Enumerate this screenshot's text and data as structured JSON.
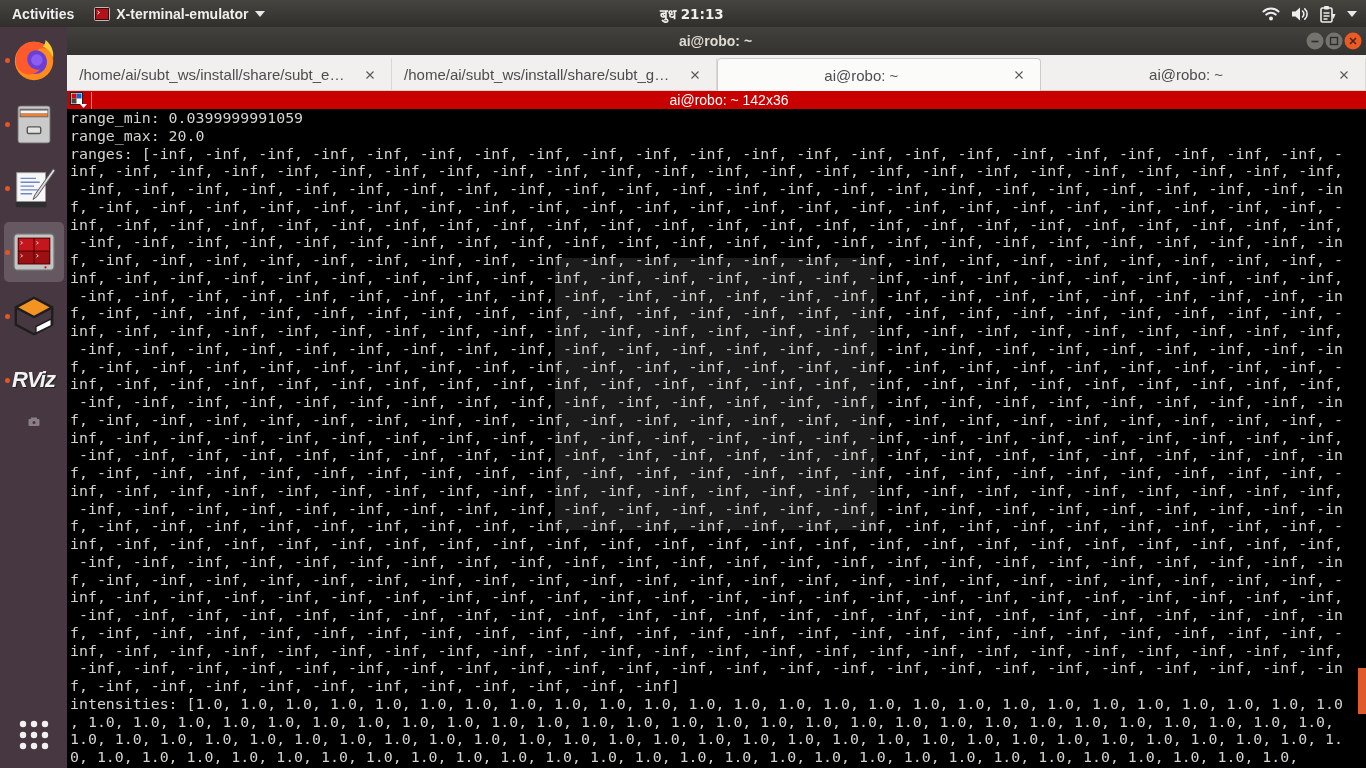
{
  "top_bar": {
    "activities": "Activities",
    "app_menu": "X-terminal-emulator",
    "clock": "बुध 21:13"
  },
  "dock": {
    "items": [
      {
        "kind": "browser",
        "running": true,
        "selected": false
      },
      {
        "kind": "files",
        "running": true,
        "selected": false
      },
      {
        "kind": "editor",
        "running": true,
        "selected": false
      },
      {
        "kind": "terminal",
        "running": true,
        "selected": true
      },
      {
        "kind": "box",
        "running": true,
        "selected": false
      },
      {
        "kind": "logo",
        "logo_text": "RViz",
        "running": true,
        "selected": false
      },
      {
        "kind": "drive",
        "running": false,
        "selected": false
      }
    ]
  },
  "window": {
    "title": "ai@robo: ~"
  },
  "tabs": [
    {
      "label": "/home/ai/subt_ws/install/share/subt_e…",
      "selected": false
    },
    {
      "label": "/home/ai/subt_ws/install/share/subt_g…",
      "selected": false
    },
    {
      "label": "ai@robo: ~",
      "selected": true
    },
    {
      "label": "ai@robo: ~",
      "selected": false
    }
  ],
  "terminal": {
    "title": "ai@robo: ~ 142x36",
    "lines": [
      "range_min: 0.0399999991059",
      "range_max: 20.0",
      "ranges: [-inf, -inf, -inf, -inf, -inf, -inf, -inf, -inf, -inf, -inf, -inf, -inf, -inf, -inf, -inf, -inf, -inf, -inf, -inf, -inf, -inf, -inf, -",
      "inf, -inf, -inf, -inf, -inf, -inf, -inf, -inf, -inf, -inf, -inf, -inf, -inf, -inf, -inf, -inf, -inf, -inf, -inf, -inf, -inf, -inf, -inf, -inf,",
      " -inf, -inf, -inf, -inf, -inf, -inf, -inf, -inf, -inf, -inf, -inf, -inf, -inf, -inf, -inf, -inf, -inf, -inf, -inf, -inf, -inf, -inf, -inf, -in",
      "f, -inf, -inf, -inf, -inf, -inf, -inf, -inf, -inf, -inf, -inf, -inf, -inf, -inf, -inf, -inf, -inf, -inf, -inf, -inf, -inf, -inf, -inf, -inf, -",
      "inf, -inf, -inf, -inf, -inf, -inf, -inf, -inf, -inf, -inf, -inf, -inf, -inf, -inf, -inf, -inf, -inf, -inf, -inf, -inf, -inf, -inf, -inf, -inf,",
      " -inf, -inf, -inf, -inf, -inf, -inf, -inf, -inf, -inf, -inf, -inf, -inf, -inf, -inf, -inf, -inf, -inf, -inf, -inf, -inf, -inf, -inf, -inf, -in",
      "f, -inf, -inf, -inf, -inf, -inf, -inf, -inf, -inf, -inf, -inf, -inf, -inf, -inf, -inf, -inf, -inf, -inf, -inf, -inf, -inf, -inf, -inf, -inf, -",
      "inf, -inf, -inf, -inf, -inf, -inf, -inf, -inf, -inf, -inf, -inf, -inf, -inf, -inf, -inf, -inf, -inf, -inf, -inf, -inf, -inf, -inf, -inf, -inf,",
      " -inf, -inf, -inf, -inf, -inf, -inf, -inf, -inf, -inf, -inf, -inf, -inf, -inf, -inf, -inf, -inf, -inf, -inf, -inf, -inf, -inf, -inf, -inf, -in",
      "f, -inf, -inf, -inf, -inf, -inf, -inf, -inf, -inf, -inf, -inf, -inf, -inf, -inf, -inf, -inf, -inf, -inf, -inf, -inf, -inf, -inf, -inf, -inf, -",
      "inf, -inf, -inf, -inf, -inf, -inf, -inf, -inf, -inf, -inf, -inf, -inf, -inf, -inf, -inf, -inf, -inf, -inf, -inf, -inf, -inf, -inf, -inf, -inf,",
      " -inf, -inf, -inf, -inf, -inf, -inf, -inf, -inf, -inf, -inf, -inf, -inf, -inf, -inf, -inf, -inf, -inf, -inf, -inf, -inf, -inf, -inf, -inf, -in",
      "f, -inf, -inf, -inf, -inf, -inf, -inf, -inf, -inf, -inf, -inf, -inf, -inf, -inf, -inf, -inf, -inf, -inf, -inf, -inf, -inf, -inf, -inf, -inf, -",
      "inf, -inf, -inf, -inf, -inf, -inf, -inf, -inf, -inf, -inf, -inf, -inf, -inf, -inf, -inf, -inf, -inf, -inf, -inf, -inf, -inf, -inf, -inf, -inf,",
      " -inf, -inf, -inf, -inf, -inf, -inf, -inf, -inf, -inf, -inf, -inf, -inf, -inf, -inf, -inf, -inf, -inf, -inf, -inf, -inf, -inf, -inf, -inf, -in",
      "f, -inf, -inf, -inf, -inf, -inf, -inf, -inf, -inf, -inf, -inf, -inf, -inf, -inf, -inf, -inf, -inf, -inf, -inf, -inf, -inf, -inf, -inf, -inf, -",
      "inf, -inf, -inf, -inf, -inf, -inf, -inf, -inf, -inf, -inf, -inf, -inf, -inf, -inf, -inf, -inf, -inf, -inf, -inf, -inf, -inf, -inf, -inf, -inf,",
      " -inf, -inf, -inf, -inf, -inf, -inf, -inf, -inf, -inf, -inf, -inf, -inf, -inf, -inf, -inf, -inf, -inf, -inf, -inf, -inf, -inf, -inf, -inf, -in",
      "f, -inf, -inf, -inf, -inf, -inf, -inf, -inf, -inf, -inf, -inf, -inf, -inf, -inf, -inf, -inf, -inf, -inf, -inf, -inf, -inf, -inf, -inf, -inf, -",
      "inf, -inf, -inf, -inf, -inf, -inf, -inf, -inf, -inf, -inf, -inf, -inf, -inf, -inf, -inf, -inf, -inf, -inf, -inf, -inf, -inf, -inf, -inf, -inf,",
      " -inf, -inf, -inf, -inf, -inf, -inf, -inf, -inf, -inf, -inf, -inf, -inf, -inf, -inf, -inf, -inf, -inf, -inf, -inf, -inf, -inf, -inf, -inf, -in",
      "f, -inf, -inf, -inf, -inf, -inf, -inf, -inf, -inf, -inf, -inf, -inf, -inf, -inf, -inf, -inf, -inf, -inf, -inf, -inf, -inf, -inf, -inf, -inf, -",
      "inf, -inf, -inf, -inf, -inf, -inf, -inf, -inf, -inf, -inf, -inf, -inf, -inf, -inf, -inf, -inf, -inf, -inf, -inf, -inf, -inf, -inf, -inf, -inf,",
      " -inf, -inf, -inf, -inf, -inf, -inf, -inf, -inf, -inf, -inf, -inf, -inf, -inf, -inf, -inf, -inf, -inf, -inf, -inf, -inf, -inf, -inf, -inf, -in",
      "f, -inf, -inf, -inf, -inf, -inf, -inf, -inf, -inf, -inf, -inf, -inf, -inf, -inf, -inf, -inf, -inf, -inf, -inf, -inf, -inf, -inf, -inf, -inf, -",
      "inf, -inf, -inf, -inf, -inf, -inf, -inf, -inf, -inf, -inf, -inf, -inf, -inf, -inf, -inf, -inf, -inf, -inf, -inf, -inf, -inf, -inf, -inf, -inf,",
      " -inf, -inf, -inf, -inf, -inf, -inf, -inf, -inf, -inf, -inf, -inf, -inf, -inf, -inf, -inf, -inf, -inf, -inf, -inf, -inf, -inf, -inf, -inf, -in",
      "f, -inf, -inf, -inf, -inf, -inf, -inf, -inf, -inf, -inf, -inf, -inf, -inf, -inf, -inf, -inf, -inf, -inf, -inf, -inf, -inf, -inf, -inf, -inf, -",
      "inf, -inf, -inf, -inf, -inf, -inf, -inf, -inf, -inf, -inf, -inf, -inf, -inf, -inf, -inf, -inf, -inf, -inf, -inf, -inf, -inf, -inf, -inf, -inf,",
      " -inf, -inf, -inf, -inf, -inf, -inf, -inf, -inf, -inf, -inf, -inf, -inf, -inf, -inf, -inf, -inf, -inf, -inf, -inf, -inf, -inf, -inf, -inf, -in",
      "f, -inf, -inf, -inf, -inf, -inf, -inf, -inf, -inf, -inf, -inf, -inf]",
      "intensities: [1.0, 1.0, 1.0, 1.0, 1.0, 1.0, 1.0, 1.0, 1.0, 1.0, 1.0, 1.0, 1.0, 1.0, 1.0, 1.0, 1.0, 1.0, 1.0, 1.0, 1.0, 1.0, 1.0, 1.0, 1.0, 1.0",
      ", 1.0, 1.0, 1.0, 1.0, 1.0, 1.0, 1.0, 1.0, 1.0, 1.0, 1.0, 1.0, 1.0, 1.0, 1.0, 1.0, 1.0, 1.0, 1.0, 1.0, 1.0, 1.0, 1.0, 1.0, 1.0, 1.0, 1.0, 1.0,",
      "1.0, 1.0, 1.0, 1.0, 1.0, 1.0, 1.0, 1.0, 1.0, 1.0, 1.0, 1.0, 1.0, 1.0, 1.0, 1.0, 1.0, 1.0, 1.0, 1.0, 1.0, 1.0, 1.0, 1.0, 1.0, 1.0, 1.0, 1.0, 1.",
      "0, 1.0, 1.0, 1.0, 1.0, 1.0, 1.0, 1.0, 1.0, 1.0, 1.0, 1.0, 1.0, 1.0, 1.0, 1.0, 1.0, 1.0, 1.0, 1.0, 1.0, 1.0, 1.0, 1.0, 1.0, 1.0, 1.0, 1.0,"
    ]
  }
}
